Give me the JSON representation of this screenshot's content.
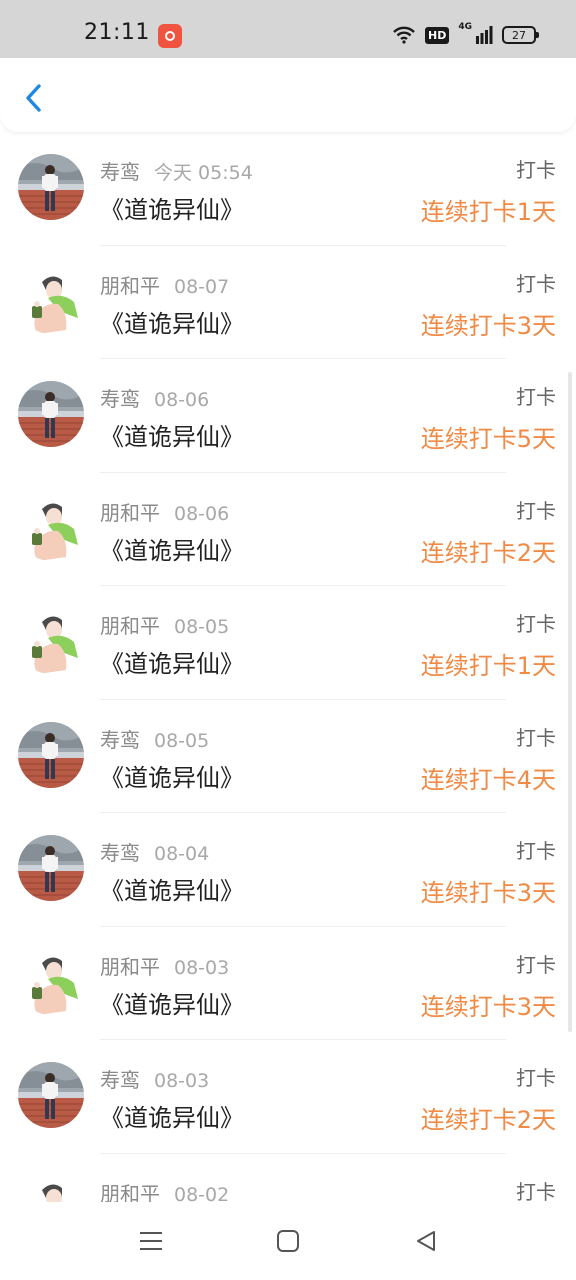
{
  "status": {
    "time": "21:11",
    "network": "4G",
    "hd": "HD",
    "battery": "27"
  },
  "colors": {
    "accent": "#1e88e5",
    "streak": "#f08a45"
  },
  "items": [
    {
      "avatar": "boy-on-wall-avatar",
      "name": "寿鸾",
      "date": "今天 05:54",
      "book": "《道诡异仙》",
      "tag": "打卡",
      "streak": "连续打卡1天"
    },
    {
      "avatar": "green-hood-avatar",
      "name": "朋和平",
      "date": "08-07",
      "book": "《道诡异仙》",
      "tag": "打卡",
      "streak": "连续打卡3天"
    },
    {
      "avatar": "boy-on-wall-avatar",
      "name": "寿鸾",
      "date": "08-06",
      "book": "《道诡异仙》",
      "tag": "打卡",
      "streak": "连续打卡5天"
    },
    {
      "avatar": "green-hood-avatar",
      "name": "朋和平",
      "date": "08-06",
      "book": "《道诡异仙》",
      "tag": "打卡",
      "streak": "连续打卡2天"
    },
    {
      "avatar": "green-hood-avatar",
      "name": "朋和平",
      "date": "08-05",
      "book": "《道诡异仙》",
      "tag": "打卡",
      "streak": "连续打卡1天"
    },
    {
      "avatar": "boy-on-wall-avatar",
      "name": "寿鸾",
      "date": "08-05",
      "book": "《道诡异仙》",
      "tag": "打卡",
      "streak": "连续打卡4天"
    },
    {
      "avatar": "boy-on-wall-avatar",
      "name": "寿鸾",
      "date": "08-04",
      "book": "《道诡异仙》",
      "tag": "打卡",
      "streak": "连续打卡3天"
    },
    {
      "avatar": "green-hood-avatar",
      "name": "朋和平",
      "date": "08-03",
      "book": "《道诡异仙》",
      "tag": "打卡",
      "streak": "连续打卡3天"
    },
    {
      "avatar": "boy-on-wall-avatar",
      "name": "寿鸾",
      "date": "08-03",
      "book": "《道诡异仙》",
      "tag": "打卡",
      "streak": "连续打卡2天"
    },
    {
      "avatar": "green-hood-avatar",
      "name": "朋和平",
      "date": "08-02",
      "book": "",
      "tag": "打卡",
      "streak": ""
    }
  ]
}
